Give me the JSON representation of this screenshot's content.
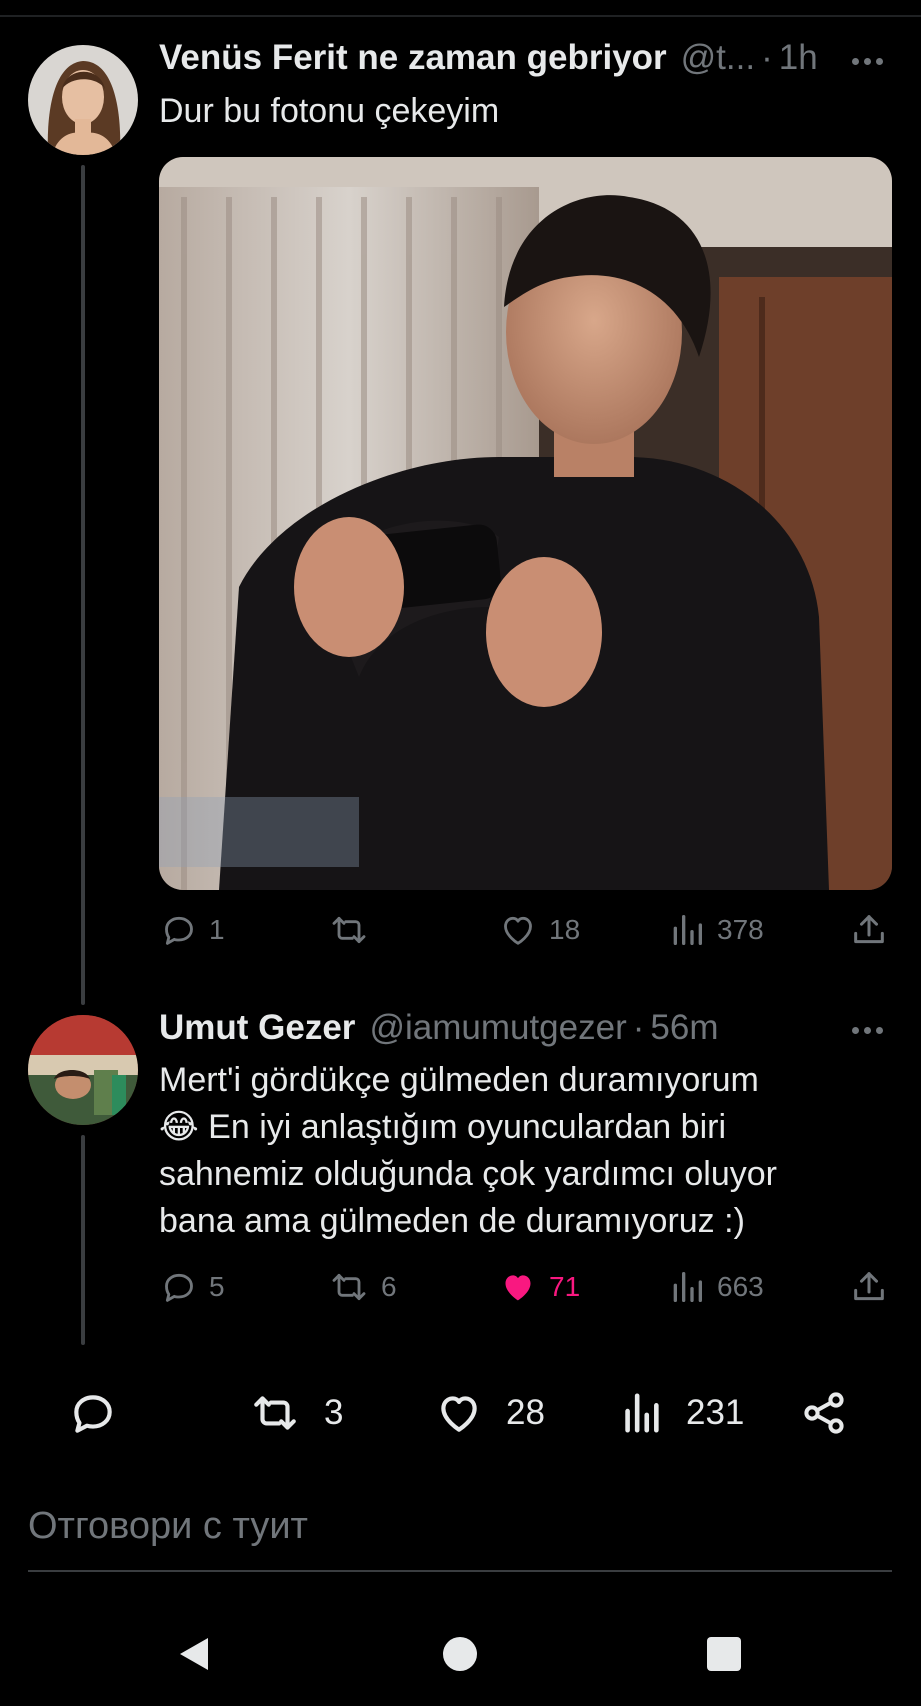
{
  "tweet1": {
    "name": "Venüs Ferit ne zaman gebriyor",
    "handle": "@t...",
    "time": "1h",
    "text": "Dur bu fotonu çekeyim",
    "media_icon": "photo-man-with-phone",
    "stats": {
      "replies": "1",
      "retweets": "",
      "likes": "18",
      "views": "378"
    }
  },
  "tweet2": {
    "name": "Umut Gezer",
    "handle": "@iamumutgezer",
    "time": "56m",
    "lines": [
      "Mert'i gördükçe gülmeden duramıyorum",
      "😂 En iyi anlaştığım oyunculardan biri",
      "sahnemiz olduğunda çok yardımcı oluyor",
      "bana ama gülmeden de duramıyoruz :)"
    ],
    "stats": {
      "replies": "5",
      "retweets": "6",
      "likes": "71",
      "views": "663"
    }
  },
  "main_stats": {
    "retweets": "3",
    "likes": "28",
    "views": "231"
  },
  "reply_placeholder": "Отговори с туит",
  "colors": {
    "like": "#f91880",
    "muted": "#71767b",
    "text": "#e7e9ea",
    "background": "#000000"
  }
}
